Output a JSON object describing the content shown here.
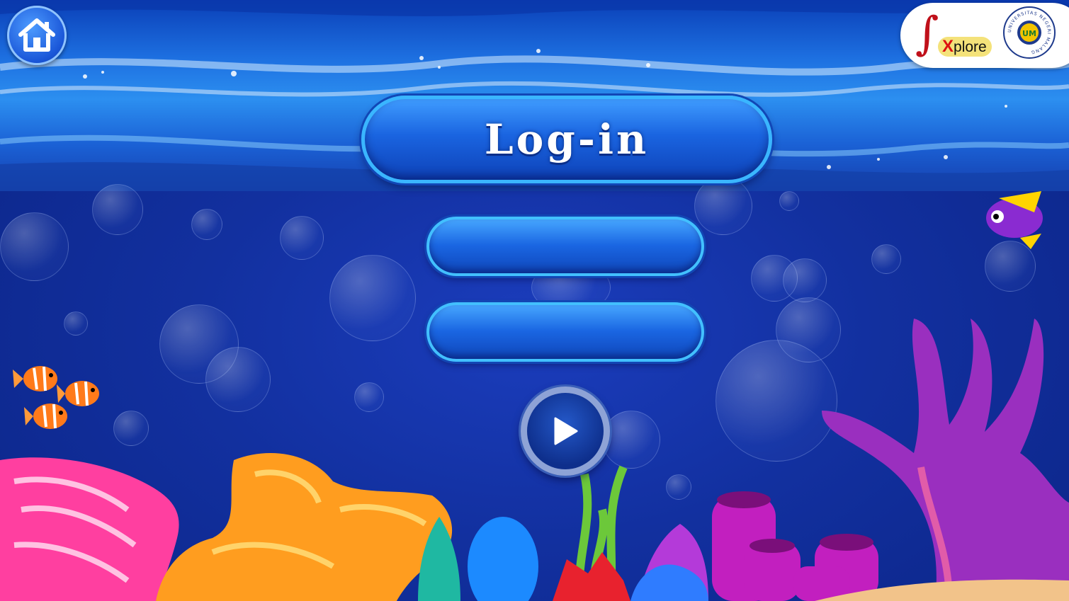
{
  "screen": {
    "title": "Log-in",
    "username": {
      "value": "",
      "placeholder": ""
    },
    "password": {
      "value": "",
      "placeholder": ""
    }
  },
  "buttons": {
    "home_icon": "home-icon",
    "play_icon": "play-icon"
  },
  "branding": {
    "integral_symbol": "∫",
    "app_name_x": "X",
    "app_name_rest": "plore",
    "university_seal_text": "UNIVERSITAS NEGERI MALANG",
    "seal_initials": "UM"
  },
  "colors": {
    "accent": "#1a64e0",
    "border": "#3ab6ff",
    "logo_red": "#c0101a",
    "logo_yellow": "#f4e27a"
  }
}
